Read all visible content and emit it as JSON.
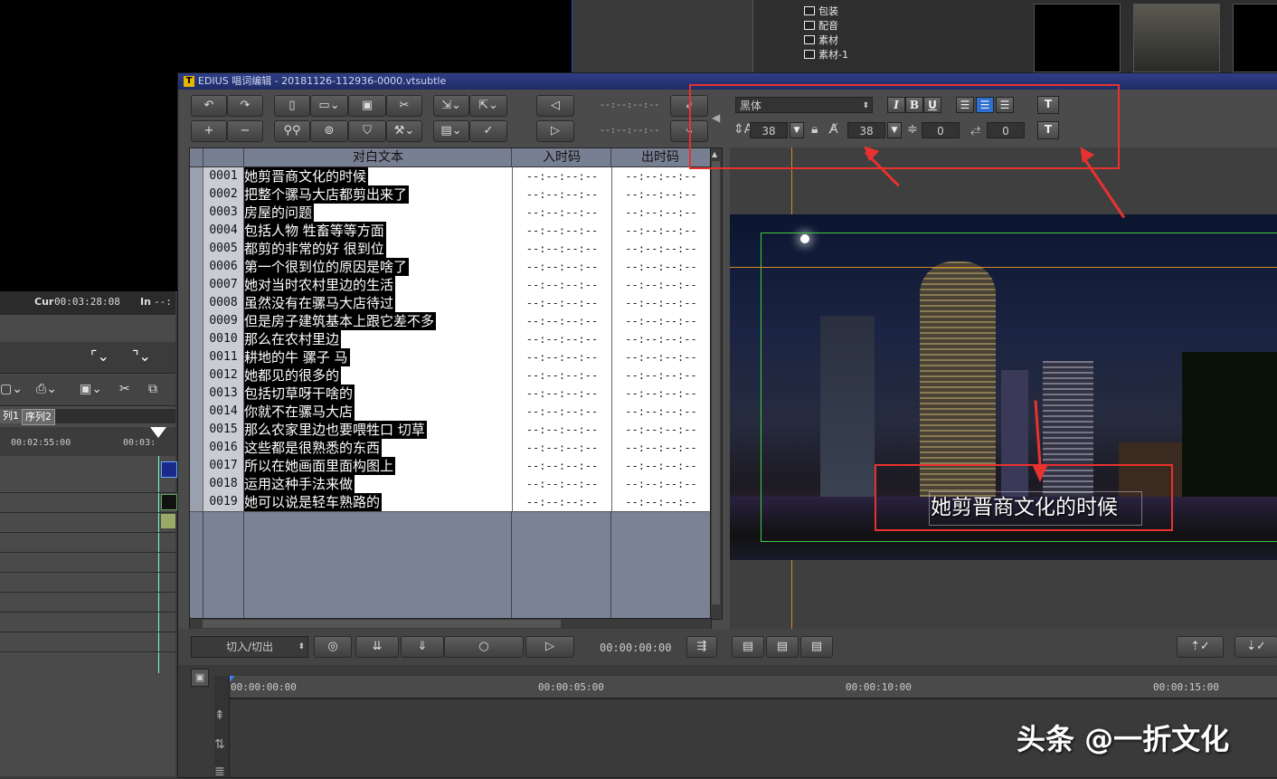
{
  "background_app": {
    "bin_items": [
      "包装",
      "配音",
      "素材",
      "素材-1"
    ],
    "timecode_label": "Cur",
    "timecode_value": "00:03:28:08",
    "in_label": "In",
    "in_value": "--:",
    "sequence_tabs": [
      "列1",
      "序列2"
    ],
    "ruler_times": [
      "00:02:55:00",
      "00:03:"
    ]
  },
  "window": {
    "title": "EDIUS 唱词编辑 - 20181126-112936-0000.vtsubtle",
    "logo_letter": "T"
  },
  "toolbar": {
    "undo_icon": "undo-icon",
    "redo_icon": "redo-icon",
    "timecode_in": "--:--:--:--",
    "timecode_out": "--:--:--:--"
  },
  "table": {
    "headers": [
      "对白文本",
      "入时码",
      "出时码"
    ],
    "rows": [
      {
        "num": "0001",
        "text": "她剪晋商文化的时候",
        "tin": "--:--:--:--",
        "tout": "--:--:--:--"
      },
      {
        "num": "0002",
        "text": "把整个骡马大店都剪出来了",
        "tin": "--:--:--:--",
        "tout": "--:--:--:--"
      },
      {
        "num": "0003",
        "text": "房屋的问题",
        "tin": "--:--:--:--",
        "tout": "--:--:--:--"
      },
      {
        "num": "0004",
        "text": "包括人物 牲畜等等方面",
        "tin": "--:--:--:--",
        "tout": "--:--:--:--"
      },
      {
        "num": "0005",
        "text": "都剪的非常的好 很到位",
        "tin": "--:--:--:--",
        "tout": "--:--:--:--"
      },
      {
        "num": "0006",
        "text": "第一个很到位的原因是啥了",
        "tin": "--:--:--:--",
        "tout": "--:--:--:--"
      },
      {
        "num": "0007",
        "text": "她对当时农村里边的生活",
        "tin": "--:--:--:--",
        "tout": "--:--:--:--"
      },
      {
        "num": "0008",
        "text": "虽然没有在骡马大店待过",
        "tin": "--:--:--:--",
        "tout": "--:--:--:--"
      },
      {
        "num": "0009",
        "text": "但是房子建筑基本上跟它差不多",
        "tin": "--:--:--:--",
        "tout": "--:--:--:--"
      },
      {
        "num": "0010",
        "text": "那么在农村里边",
        "tin": "--:--:--:--",
        "tout": "--:--:--:--"
      },
      {
        "num": "0011",
        "text": "耕地的牛 骡子 马",
        "tin": "--:--:--:--",
        "tout": "--:--:--:--"
      },
      {
        "num": "0012",
        "text": "她都见的很多的",
        "tin": "--:--:--:--",
        "tout": "--:--:--:--"
      },
      {
        "num": "0013",
        "text": "包括切草呀干啥的",
        "tin": "--:--:--:--",
        "tout": "--:--:--:--"
      },
      {
        "num": "0014",
        "text": "你就不在骡马大店",
        "tin": "--:--:--:--",
        "tout": "--:--:--:--"
      },
      {
        "num": "0015",
        "text": "那么农家里边也要喂牲口 切草",
        "tin": "--:--:--:--",
        "tout": "--:--:--:--"
      },
      {
        "num": "0016",
        "text": "这些都是很熟悉的东西",
        "tin": "--:--:--:--",
        "tout": "--:--:--:--"
      },
      {
        "num": "0017",
        "text": "所以在她画面里面构图上",
        "tin": "--:--:--:--",
        "tout": "--:--:--:--"
      },
      {
        "num": "0018",
        "text": "运用这种手法来做",
        "tin": "--:--:--:--",
        "tout": "--:--:--:--"
      },
      {
        "num": "0019",
        "text": "她可以说是轻车熟路的",
        "tin": "--:--:--:--",
        "tout": "--:--:--:--"
      }
    ]
  },
  "format": {
    "font_name": "黑体",
    "italic": "I",
    "bold": "B",
    "underline": "U",
    "font_size": "38",
    "font_size_2": "38",
    "spacing_v": "0",
    "spacing_h": "0",
    "text_tool_label": "T"
  },
  "preview": {
    "subtitle_text": "她剪晋商文化的时候",
    "accent_red": "#e8322f"
  },
  "controls": {
    "mode_select": "切入/切出",
    "timecode": "00:00:00:00"
  },
  "timeline": {
    "ticks": [
      "00:00:00:00",
      "00:00:05:00",
      "00:00:10:00",
      "00:00:15:00"
    ]
  },
  "watermark": "头条 @一折文化"
}
